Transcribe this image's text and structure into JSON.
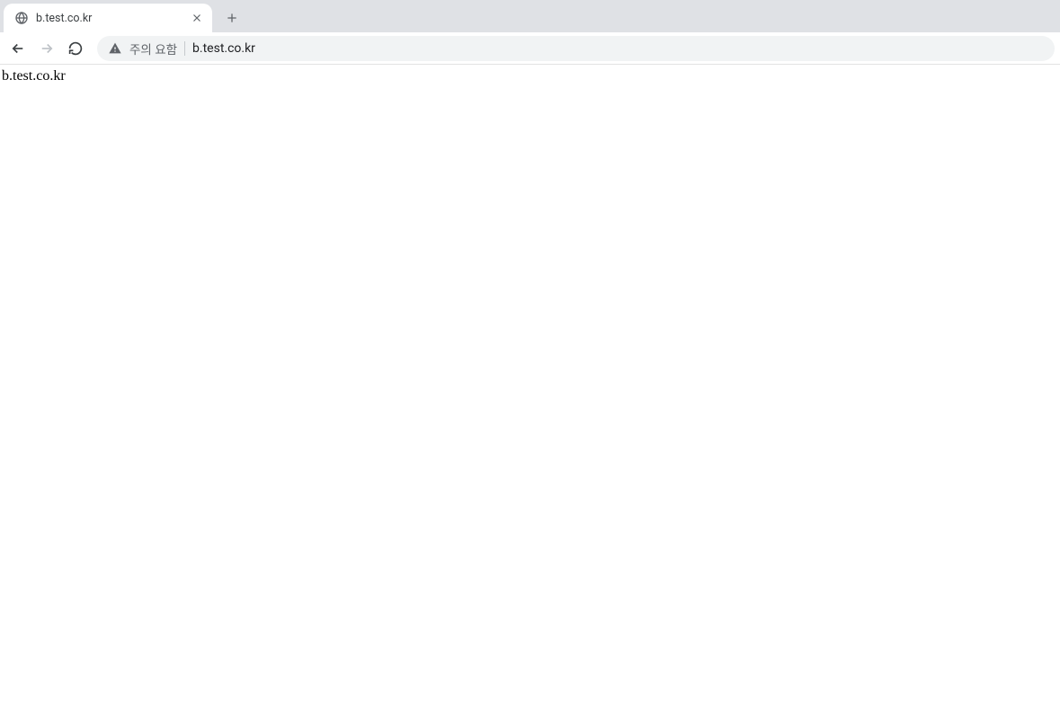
{
  "tab": {
    "title": "b.test.co.kr"
  },
  "omnibox": {
    "security_label": "주의 요함",
    "url": "b.test.co.kr"
  },
  "page": {
    "body_text": "b.test.co.kr"
  }
}
